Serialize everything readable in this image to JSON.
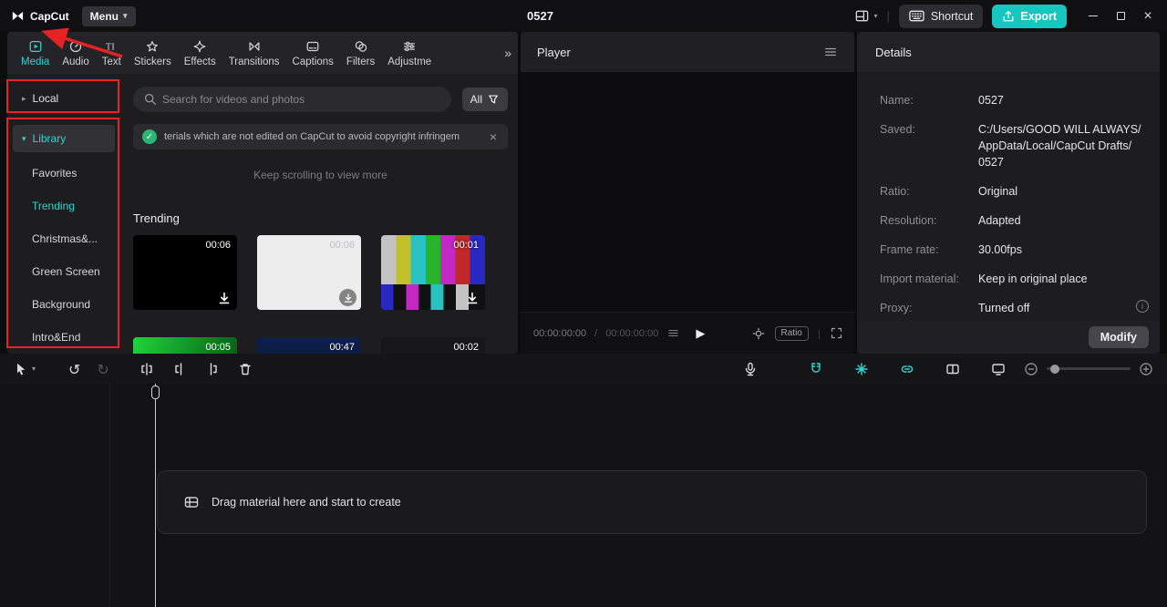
{
  "colors": {
    "accent": "#30d5cf",
    "annotation_red": "#e62222",
    "export_teal": "#17c6be",
    "check_green": "#2bb673"
  },
  "titlebar": {
    "app_name": "CapCut",
    "menu_label": "Menu",
    "project_title": "0527",
    "shortcut_label": "Shortcut",
    "export_label": "Export"
  },
  "icons": {
    "caret_right": "▸",
    "caret_down": "▾",
    "double_chevron": "»",
    "close": "×",
    "play": "▶",
    "undo": "↺",
    "redo": "↻",
    "info": "i"
  },
  "tabs": [
    {
      "label": "Media",
      "active": true
    },
    {
      "label": "Audio",
      "active": false
    },
    {
      "label": "Text",
      "active": false
    },
    {
      "label": "Stickers",
      "active": false
    },
    {
      "label": "Effects",
      "active": false
    },
    {
      "label": "Transitions",
      "active": false
    },
    {
      "label": "Captions",
      "active": false
    },
    {
      "label": "Filters",
      "active": false
    },
    {
      "label": "Adjustme",
      "active": false
    }
  ],
  "sidebar": {
    "local_label": "Local",
    "library_label": "Library",
    "items": [
      {
        "label": "Favorites",
        "active": false
      },
      {
        "label": "Trending",
        "active": true
      },
      {
        "label": "Christmas&...",
        "active": false
      },
      {
        "label": "Green Screen",
        "active": false
      },
      {
        "label": "Background",
        "active": false
      },
      {
        "label": "Intro&End",
        "active": false
      }
    ]
  },
  "media_library": {
    "search_placeholder": "Search for videos and photos",
    "filter_label": "All",
    "notice": "terials which are not edited on CapCut to avoid copyright infringem",
    "scroll_hint": "Keep scrolling to view more",
    "section_title": "Trending",
    "thumbnails": [
      {
        "duration": "00:06"
      },
      {
        "duration": "00:06"
      },
      {
        "duration": "00:01"
      },
      {
        "duration": "00:05"
      },
      {
        "duration": "00:47"
      },
      {
        "duration": "00:02"
      }
    ]
  },
  "player": {
    "title": "Player",
    "timecode_current": "00:00:00:00",
    "timecode_separator": "/",
    "timecode_total": "00:00:00:00",
    "ratio_label": "Ratio"
  },
  "details": {
    "title": "Details",
    "fields": [
      {
        "label": "Name:",
        "value": "0527"
      },
      {
        "label": "Saved:",
        "value": "C:/Users/GOOD WILL ALWAYS/\nAppData/Local/CapCut Drafts/\n0527"
      },
      {
        "label": "Ratio:",
        "value": "Original"
      },
      {
        "label": "Resolution:",
        "value": "Adapted"
      },
      {
        "label": "Frame rate:",
        "value": "30.00fps"
      },
      {
        "label": "Import material:",
        "value": "Keep in original place"
      },
      {
        "label": "Proxy:",
        "value": "Turned off"
      }
    ],
    "modify_label": "Modify"
  },
  "timeline": {
    "drop_hint": "Drag material here and start to create"
  }
}
